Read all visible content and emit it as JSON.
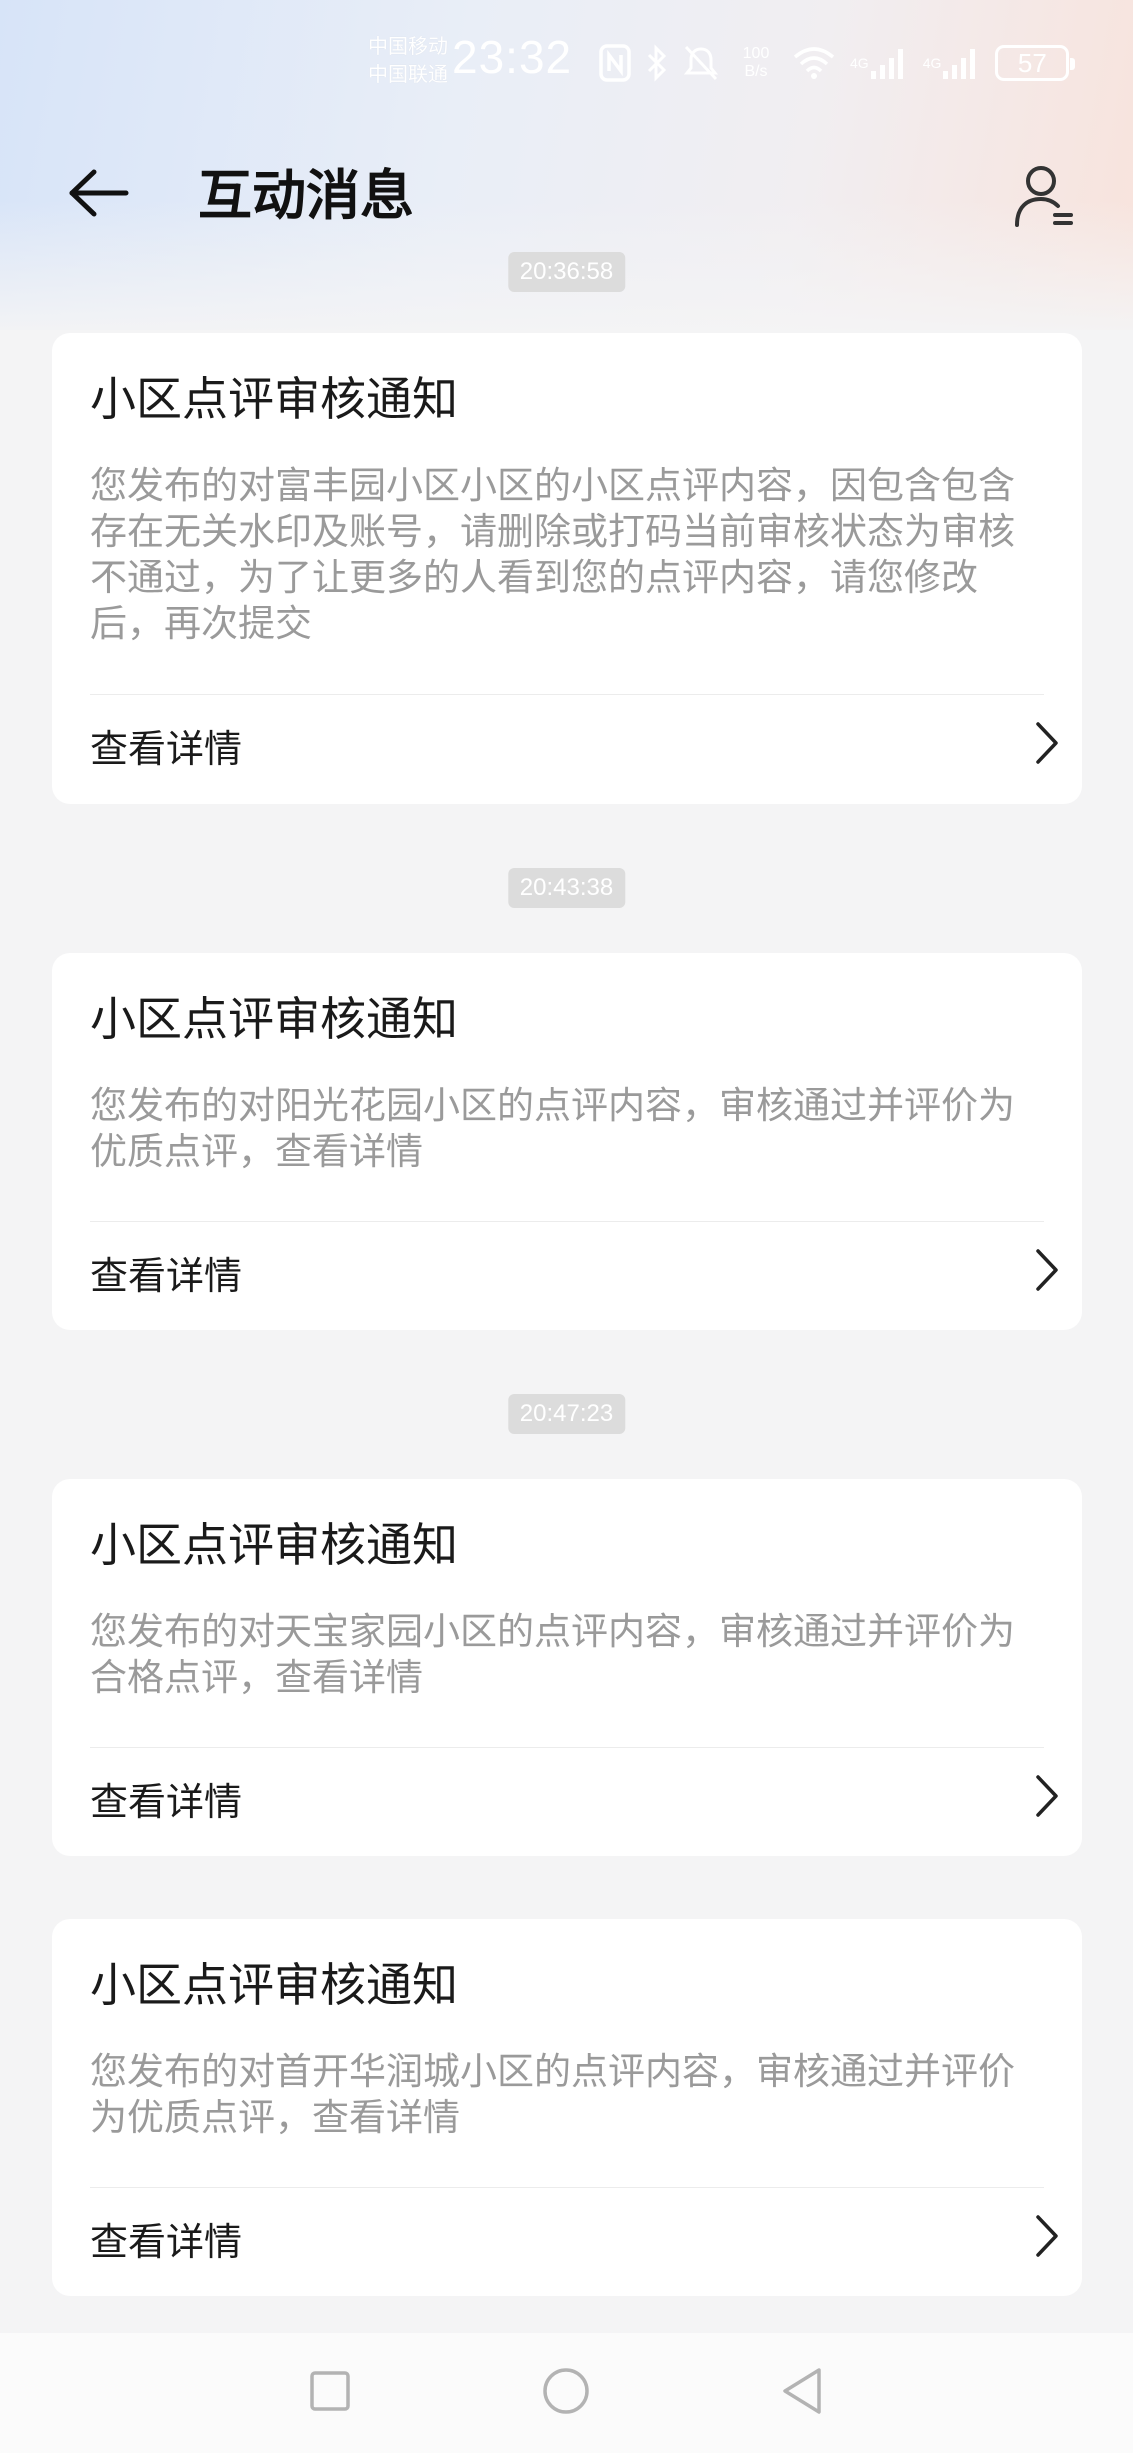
{
  "status_bar": {
    "carrier_1": "中国移动",
    "carrier_2": "中国联通",
    "time": "23:32",
    "net_speed_value": "100",
    "net_speed_unit": "B/s",
    "network_1": "4G",
    "network_2": "4G",
    "battery": "57",
    "icons": [
      "nfc-icon",
      "bluetooth-icon",
      "mute-icon",
      "wifi-icon",
      "signal-icon",
      "signal-icon",
      "battery-icon"
    ]
  },
  "header": {
    "title": "互动消息",
    "back_icon": "arrow-left-icon",
    "profile_icon": "user-settings-icon"
  },
  "messages": [
    {
      "time": "20:36:58",
      "title": "小区点评审核通知",
      "body": "您发布的对富丰园小区小区的小区点评内容，因包含包含存在无关水印及账号，请删除或打码当前审核状态为审核不通过，为了让更多的人看到您的点评内容，请您修改后，再次提交",
      "link": "查看详情"
    },
    {
      "time": "20:43:38",
      "title": "小区点评审核通知",
      "body": "您发布的对阳光花园小区的点评内容，审核通过并评价为优质点评，查看详情",
      "link": "查看详情"
    },
    {
      "time": "20:47:23",
      "title": "小区点评审核通知",
      "body": "您发布的对天宝家园小区的点评内容，审核通过并评价为合格点评，查看详情",
      "link": "查看详情"
    },
    {
      "time": "",
      "title": "小区点评审核通知",
      "body": "您发布的对首开华润城小区的点评内容，审核通过并评价为优质点评，查看详情",
      "link": "查看详情"
    }
  ],
  "nav_bar": {
    "icons": [
      "square-recents-icon",
      "circle-home-icon",
      "triangle-back-icon"
    ]
  }
}
